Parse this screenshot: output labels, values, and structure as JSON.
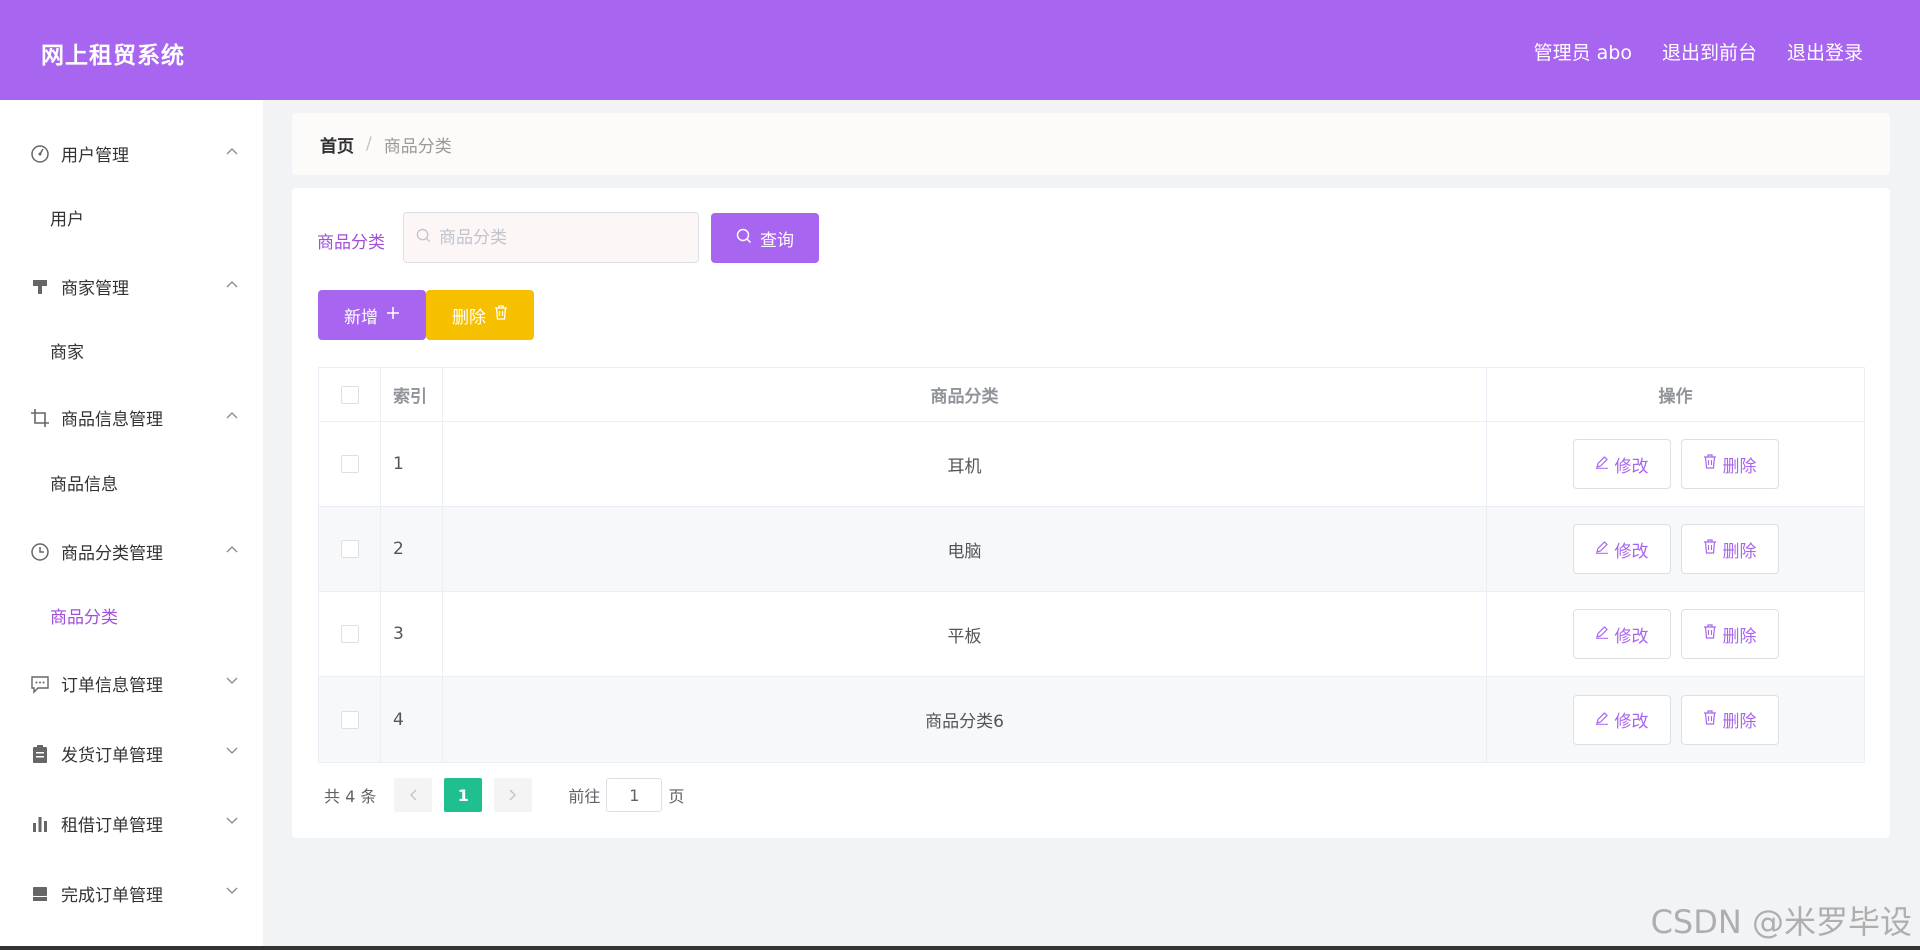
{
  "header": {
    "brand": "网上租贸系统",
    "admin_label": "管理员 abo",
    "front_label": "退出到前台",
    "logout_label": "退出登录"
  },
  "sidebar": {
    "groups": [
      {
        "title": "用户管理",
        "icon": "dashboard-icon",
        "expanded": true,
        "items": [
          "用户"
        ]
      },
      {
        "title": "商家管理",
        "icon": "brush-icon",
        "expanded": true,
        "items": [
          "商家"
        ]
      },
      {
        "title": "商品信息管理",
        "icon": "crop-icon",
        "expanded": true,
        "items": [
          "商品信息"
        ]
      },
      {
        "title": "商品分类管理",
        "icon": "clock-icon",
        "expanded": true,
        "items": [
          "商品分类"
        ]
      },
      {
        "title": "订单信息管理",
        "icon": "chat-icon",
        "expanded": false,
        "items": []
      },
      {
        "title": "发货订单管理",
        "icon": "clipboard-icon",
        "expanded": false,
        "items": []
      },
      {
        "title": "租借订单管理",
        "icon": "bar-chart-icon",
        "expanded": false,
        "items": []
      },
      {
        "title": "完成订单管理",
        "icon": "shop-icon",
        "expanded": false,
        "items": []
      }
    ],
    "active_item": "商品分类"
  },
  "breadcrumb": {
    "home": "首页",
    "separator": "/",
    "current": "商品分类"
  },
  "search": {
    "label": "商品分类",
    "placeholder": "商品分类",
    "query_label": "查询"
  },
  "toolbar": {
    "add_label": "新增",
    "delete_label": "删除"
  },
  "table": {
    "columns": [
      "索引",
      "商品分类",
      "操作"
    ],
    "rows": [
      {
        "index": "1",
        "name": "耳机"
      },
      {
        "index": "2",
        "name": "电脑"
      },
      {
        "index": "3",
        "name": "平板"
      },
      {
        "index": "4",
        "name": "商品分类6"
      }
    ],
    "edit_label": "修改",
    "delete_label": "删除"
  },
  "pagination": {
    "total": "共 4 条",
    "current_page": "1",
    "goto_label": "前往",
    "goto_value": "1",
    "page_unit": "页"
  },
  "watermark": "CSDN @米罗毕设",
  "colors": {
    "header": "#a865f0",
    "accent": "#a865f0",
    "danger": "#f6c000",
    "page_active": "#1fbf8f"
  }
}
